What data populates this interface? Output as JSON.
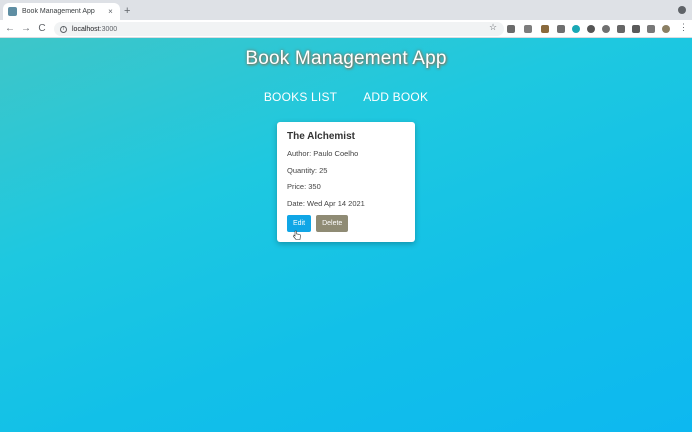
{
  "browser": {
    "tab_title": "Book Management App",
    "tab_close": "×",
    "new_tab": "+",
    "url_host": "localhost",
    "url_port": ":3000",
    "back": "←",
    "forward": "→",
    "reload": "C"
  },
  "app": {
    "title": "Book Management App",
    "nav": {
      "books_list": "BOOKS LIST",
      "add_book": "ADD BOOK"
    }
  },
  "book": {
    "title": "The Alchemist",
    "author": "Author: Paulo Coelho",
    "quantity": "Quantity: 25",
    "price": "Price: 350",
    "date": "Date: Wed Apr 14 2021",
    "edit_label": "Edit",
    "delete_label": "Delete"
  },
  "colors": {
    "edit_button": "#10a6e6",
    "delete_button": "#8f8b74"
  }
}
